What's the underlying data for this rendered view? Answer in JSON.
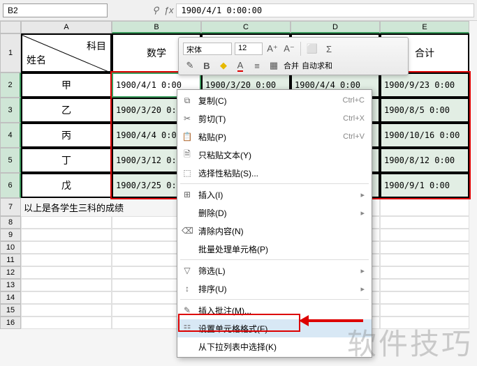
{
  "namebox": "B2",
  "fx": "1900/4/1 0:00:00",
  "cols": [
    "A",
    "B",
    "C",
    "D",
    "E"
  ],
  "rows_main": [
    "1",
    "2",
    "3",
    "4",
    "5",
    "6",
    "7"
  ],
  "rows_small": [
    "8",
    "9",
    "10",
    "11",
    "12",
    "13",
    "14",
    "15",
    "16"
  ],
  "a1": {
    "name": "姓名",
    "subject": "科目"
  },
  "headers": {
    "B": "数学",
    "C": "",
    "D": "",
    "E": "合计"
  },
  "students": [
    "甲",
    "乙",
    "丙",
    "丁",
    "戊"
  ],
  "grid": [
    [
      "1900/4/1 0:00",
      "1900/3/20 0:00",
      "1900/4/4 0:00",
      "1900/9/23 0:00"
    ],
    [
      "1900/3/20 0:00",
      "",
      "",
      "1900/8/5 0:00"
    ],
    [
      "1900/4/4 0:00",
      "",
      "",
      "1900/10/16 0:00"
    ],
    [
      "1900/3/12 0:00",
      "",
      "",
      "1900/8/12 0:00"
    ],
    [
      "1900/3/25 0:00",
      "",
      "",
      "1900/9/1 0:00"
    ]
  ],
  "note": "以上是各学生三科的成绩",
  "mini": {
    "font": "宋体",
    "size": "12",
    "merge": "合并",
    "sum": "自动求和"
  },
  "menu": {
    "copy": "复制(C)",
    "copy_sc": "Ctrl+C",
    "cut": "剪切(T)",
    "cut_sc": "Ctrl+X",
    "paste": "粘贴(P)",
    "paste_sc": "Ctrl+V",
    "paste_text": "只粘贴文本(Y)",
    "paste_special": "选择性粘贴(S)...",
    "insert": "插入(I)",
    "delete": "删除(D)",
    "clear": "清除内容(N)",
    "batch": "批量处理单元格(P)",
    "filter": "筛选(L)",
    "sort": "排序(U)",
    "comment": "插入批注(M)...",
    "format": "设置单元格格式(F)...",
    "dropdown": "从下拉列表中选择(K)"
  },
  "watermark": "软件技巧"
}
